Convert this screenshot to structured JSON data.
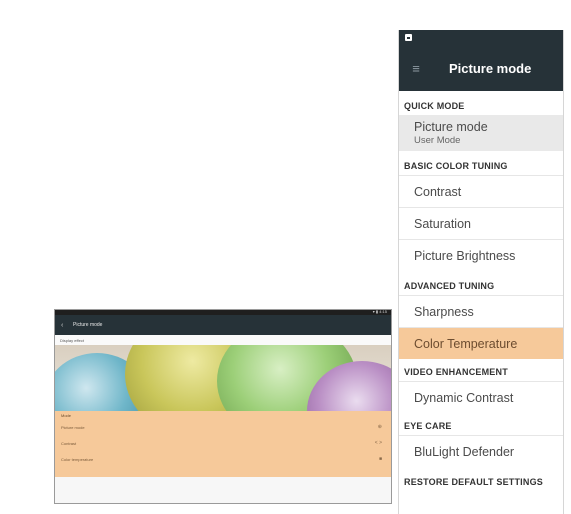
{
  "tablet": {
    "toolbar_title": "Picture mode",
    "display_label": "Display effect",
    "rows": [
      {
        "label": "Picture mode",
        "value": "⊕"
      },
      {
        "label": "Contrast",
        "value": "< >"
      },
      {
        "label": "Color temperature",
        "value": "■"
      }
    ],
    "section_label": "Mode"
  },
  "phone": {
    "toolbar_title": "Picture mode",
    "sections": {
      "quick_mode": "QUICK MODE",
      "basic_color": "BASIC COLOR TUNING",
      "advanced": "ADVANCED TUNING",
      "video": "VIDEO ENHANCEMENT",
      "eye_care": "EYE CARE",
      "restore": "RESTORE DEFAULT SETTINGS"
    },
    "items": {
      "picture_mode": "Picture mode",
      "picture_mode_value": "User Mode",
      "contrast": "Contrast",
      "saturation": "Saturation",
      "brightness": "Picture Brightness",
      "sharpness": "Sharpness",
      "color_temperature": "Color Temperature",
      "dynamic_contrast": "Dynamic Contrast",
      "blulight": "BluLight Defender"
    }
  },
  "colors": {
    "toolbar": "#263238",
    "highlight": "#f6c99a",
    "selected_row": "#e9e9e9"
  }
}
